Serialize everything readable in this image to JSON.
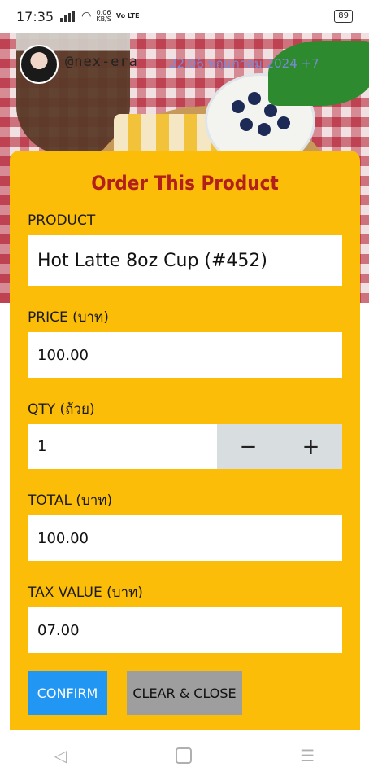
{
  "status_bar": {
    "time": "17:35",
    "net_speed": "0.06",
    "net_unit": "KB/S",
    "volte": "Vo LTE",
    "battery": "89"
  },
  "post": {
    "username": "@nex-era",
    "date": "22.06 พฤษภาคม 2024 +7"
  },
  "modal": {
    "title": "Order This Product",
    "product_label": "PRODUCT",
    "product_value": "Hot Latte 8oz Cup (#452)",
    "price_label": "PRICE (บาท)",
    "price_value": "100.00",
    "qty_label": "QTY (ถ้วย)",
    "qty_value": "1",
    "qty_decrement": "−",
    "qty_increment": "+",
    "total_label": "TOTAL (บาท)",
    "total_value": "100.00",
    "tax_label": "TAX VALUE (บาท)",
    "tax_value": "07.00",
    "confirm_label": "CONFIRM",
    "clear_close_label": "CLEAR & CLOSE"
  },
  "nav": {
    "back_icon": "◁",
    "menu_icon": "☰"
  },
  "colors": {
    "modal_bg": "#fbbd08",
    "title": "#b1201a",
    "confirm": "#2196f3",
    "clear_close": "#9e9e9e"
  }
}
